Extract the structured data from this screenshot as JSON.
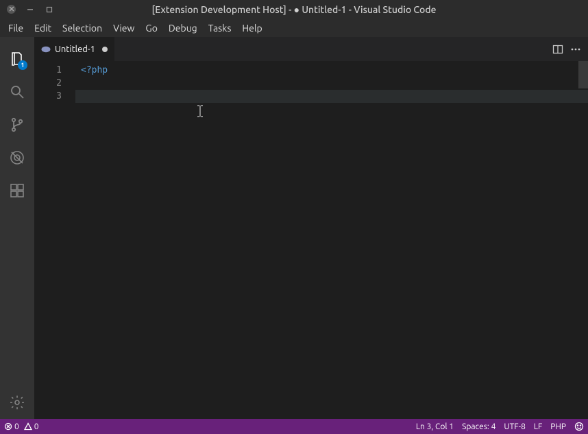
{
  "titlebar": {
    "title": "[Extension Development Host] - ● Untitled-1 - Visual Studio Code"
  },
  "menubar": {
    "items": [
      "File",
      "Edit",
      "Selection",
      "View",
      "Go",
      "Debug",
      "Tasks",
      "Help"
    ]
  },
  "activitybar": {
    "explorer_badge": "1"
  },
  "tabs": {
    "items": [
      {
        "label": "Untitled-1",
        "dirty": true,
        "language_icon": "php"
      }
    ]
  },
  "editor": {
    "lines": [
      {
        "num": "1",
        "text": "<?php",
        "class": "php-open"
      },
      {
        "num": "2",
        "text": ""
      },
      {
        "num": "3",
        "text": "",
        "current": true
      }
    ]
  },
  "statusbar": {
    "errors": "0",
    "warnings": "0",
    "cursor": "Ln 3, Col 1",
    "indent": "Spaces: 4",
    "encoding": "UTF-8",
    "eol": "LF",
    "language": "PHP"
  }
}
